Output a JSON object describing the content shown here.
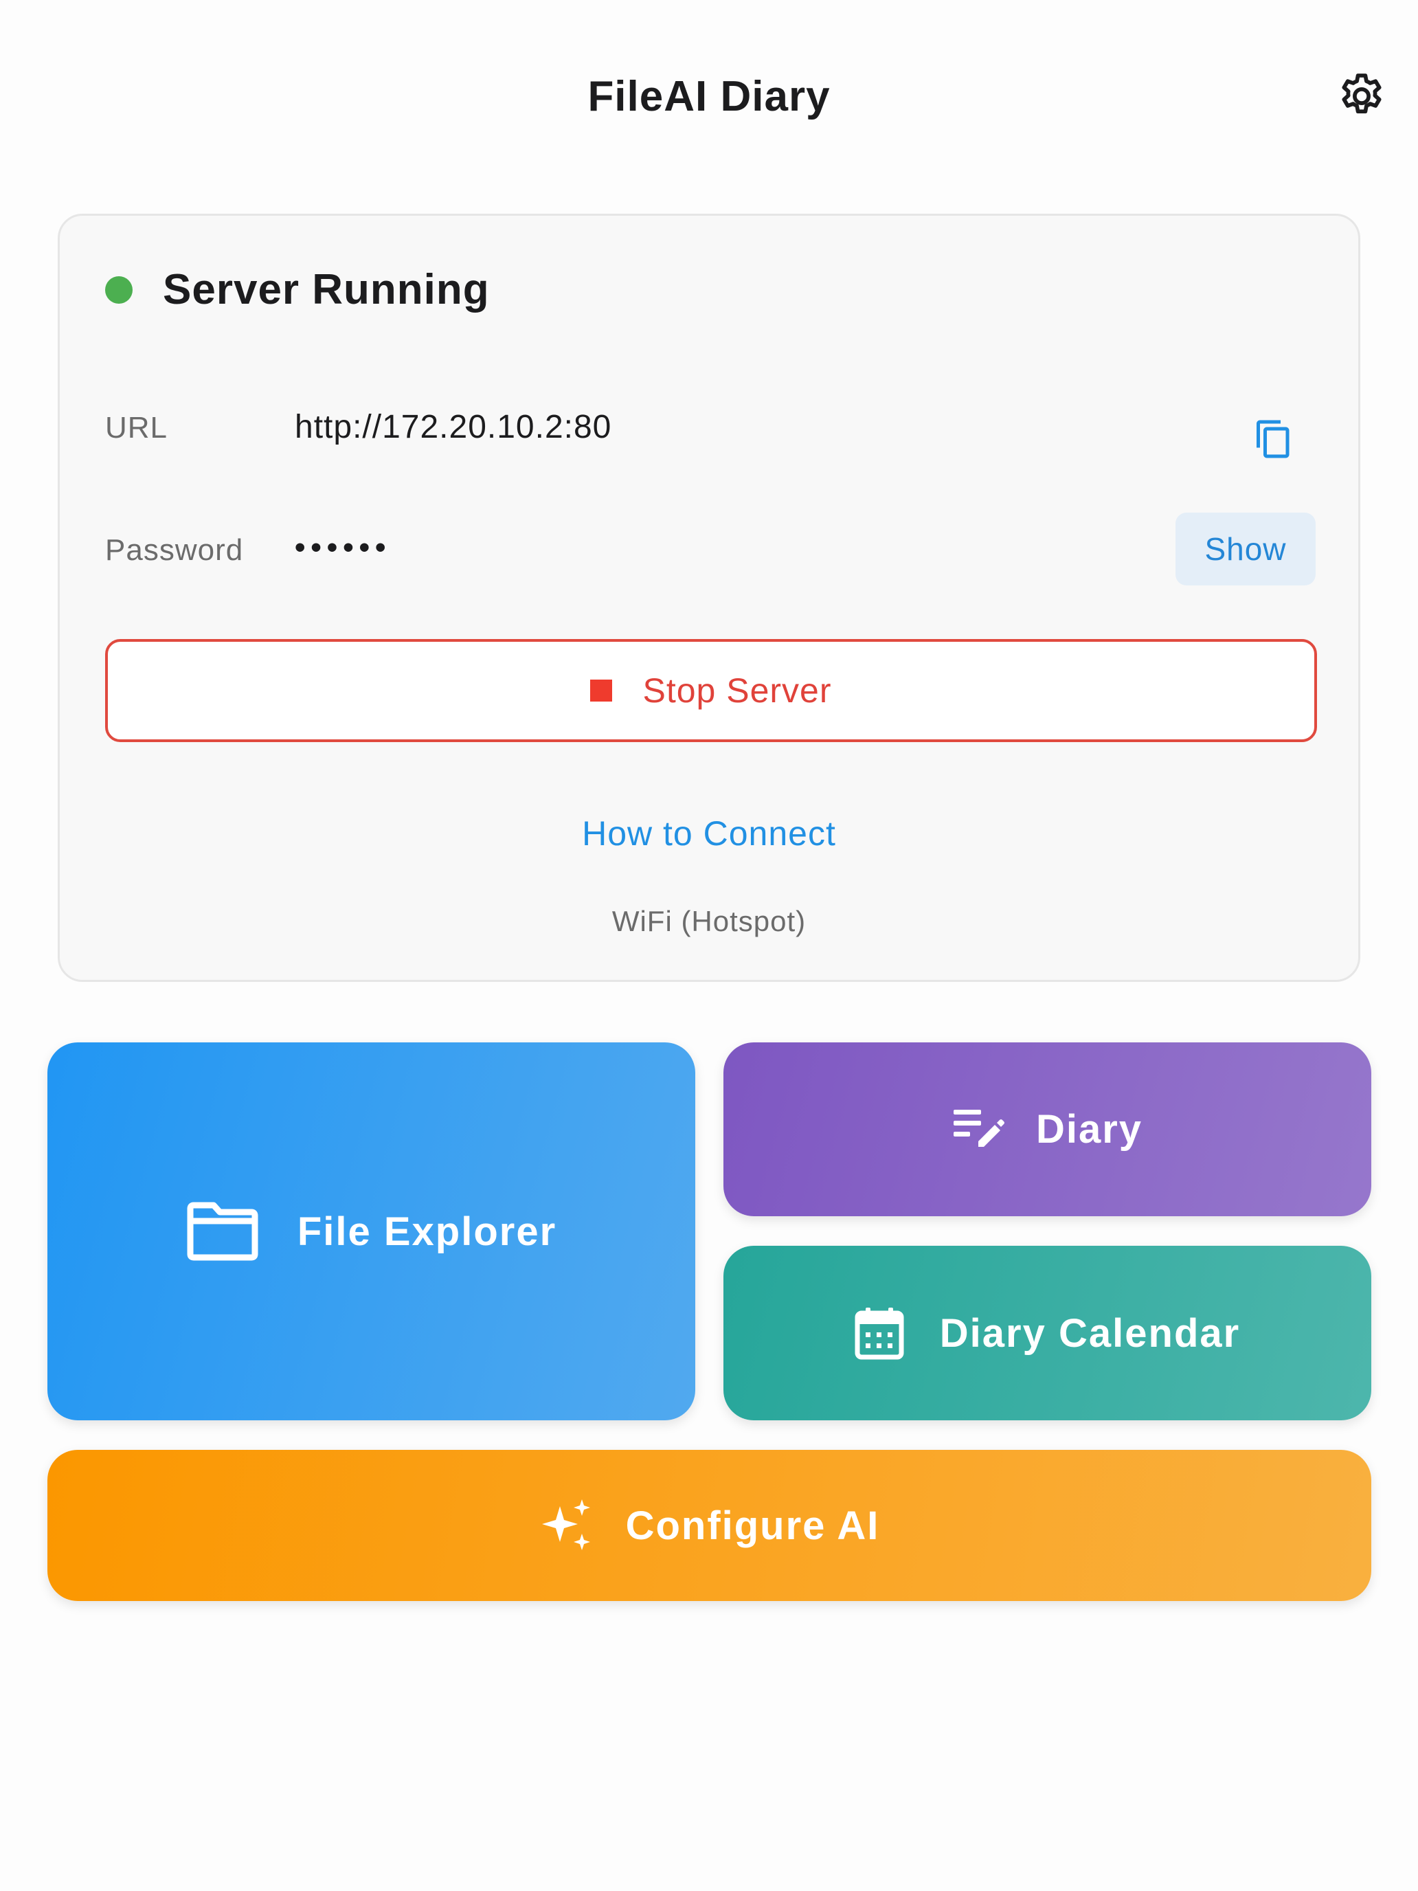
{
  "app": {
    "title": "FileAI Diary",
    "settings_icon": "gear-icon"
  },
  "server": {
    "status_text": "Server Running",
    "status_color": "#4caf50",
    "url_label": "URL",
    "url_value": "http://172.20.10.2:80",
    "copy_icon": "copy-icon",
    "password_label": "Password",
    "password_masked": "••••••",
    "show_label": "Show",
    "stop_label": "Stop Server",
    "stop_icon": "stop-square-icon",
    "how_to_connect": "How to Connect",
    "network": "WiFi (Hotspot)"
  },
  "tiles": {
    "file_explorer": {
      "label": "File Explorer",
      "icon": "folder-icon",
      "color": "#2196f3"
    },
    "diary": {
      "label": "Diary",
      "icon": "edit-note-icon",
      "color": "#7e57c2"
    },
    "diary_calendar": {
      "label": "Diary Calendar",
      "icon": "calendar-icon",
      "color": "#26a69a"
    },
    "configure_ai": {
      "label": "Configure AI",
      "icon": "sparkle-icon",
      "color": "#fb9700"
    }
  },
  "colors": {
    "accent_blue": "#2190e3",
    "danger": "#e0423a",
    "card_bg": "#f8f8f8"
  }
}
